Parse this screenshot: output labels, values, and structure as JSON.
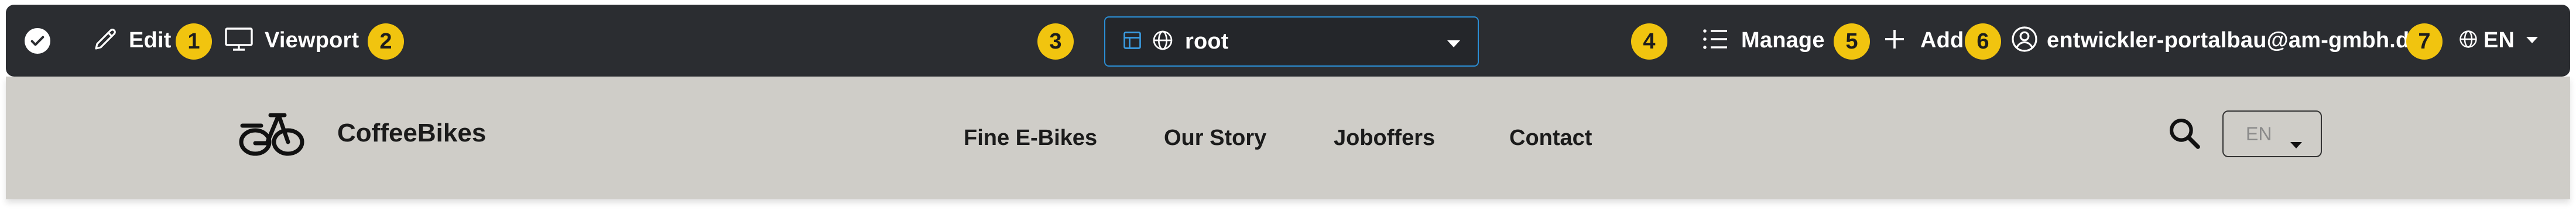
{
  "toolbar": {
    "edit_label": "Edit",
    "viewport_label": "Viewport",
    "site_selector_value": "root",
    "manage_label": "Manage",
    "add_label": "Add",
    "user_email": "entwickler-portalbau@am-gmbh.de",
    "language_label": "EN",
    "badges": [
      "1",
      "2",
      "3",
      "4",
      "5",
      "6",
      "7"
    ],
    "icons": [
      "check-icon",
      "pencil-icon",
      "monitor-icon",
      "layout-icon",
      "globe-icon",
      "chevron-down-icon",
      "list-icon",
      "plus-icon",
      "user-icon"
    ]
  },
  "website": {
    "brand_name": "CoffeeBikes",
    "nav": [
      "Fine E-Bikes",
      "Our Story",
      "Joboffers",
      "Contact"
    ],
    "language_select_value": "EN",
    "icons": [
      "bike-logo-icon",
      "search-icon",
      "caret-down-icon"
    ]
  },
  "colors": {
    "toolbar_bg": "#2b2d31",
    "badge": "#f1c40f",
    "selector_border": "#2b8fd6",
    "header_bg": "#cfcdc8"
  }
}
